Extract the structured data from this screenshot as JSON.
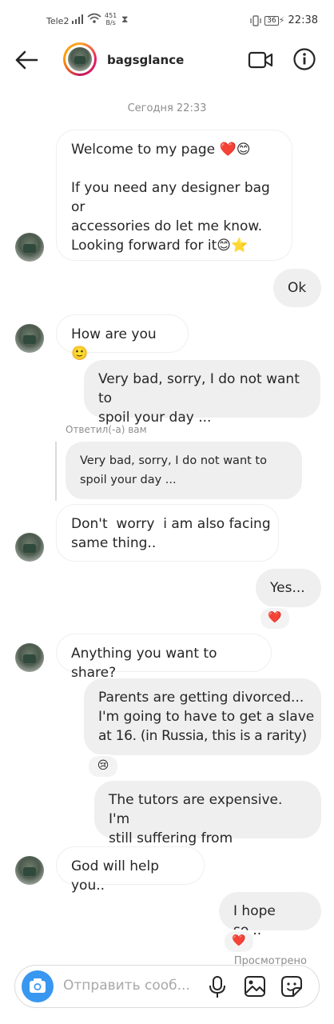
{
  "status_bar": {
    "carrier": "Tele2",
    "speed_top": "451",
    "speed_unit": "B/s",
    "battery": "36",
    "time": "22:38"
  },
  "header": {
    "username": "bagsglance"
  },
  "date_stamp": "Сегодня 22:33",
  "messages": [
    {
      "side": "in",
      "lines": [
        "Welcome to my page ❤️😊",
        "",
        "If you need any designer bag or",
        "accessories do let me know.",
        "Looking forward for it😊⭐"
      ]
    },
    {
      "side": "out",
      "text": "Ok"
    },
    {
      "side": "in",
      "text": "How are you 🙂"
    },
    {
      "side": "out",
      "lines": [
        "Very bad, sorry, I do not want to",
        "spoil your day ..."
      ]
    },
    {
      "side": "in",
      "lines": [
        "Don't  worry  i am also facing",
        "same thing.."
      ]
    },
    {
      "side": "out",
      "text": "Yes...",
      "reaction": "❤️"
    },
    {
      "side": "in",
      "text": "Anything you want to share?"
    },
    {
      "side": "out",
      "lines": [
        "Parents are getting divorced...",
        "I'm going to have to get a slave",
        "at 16. (in Russia, this is a rarity)"
      ],
      "reaction": "😢"
    },
    {
      "side": "out",
      "lines": [
        "The tutors are expensive. I'm",
        "still suffering from loneliness."
      ]
    },
    {
      "side": "in",
      "text": "God will help you.."
    },
    {
      "side": "out",
      "text": "I hope so...",
      "reaction": "❤️"
    }
  ],
  "reply": {
    "label": "Ответил(-а) вам",
    "lines": [
      "Very bad, sorry, I do not want to",
      "spoil your day ..."
    ]
  },
  "seen_label": "Просмотрено",
  "composer": {
    "placeholder": "Отправить сооб..."
  }
}
